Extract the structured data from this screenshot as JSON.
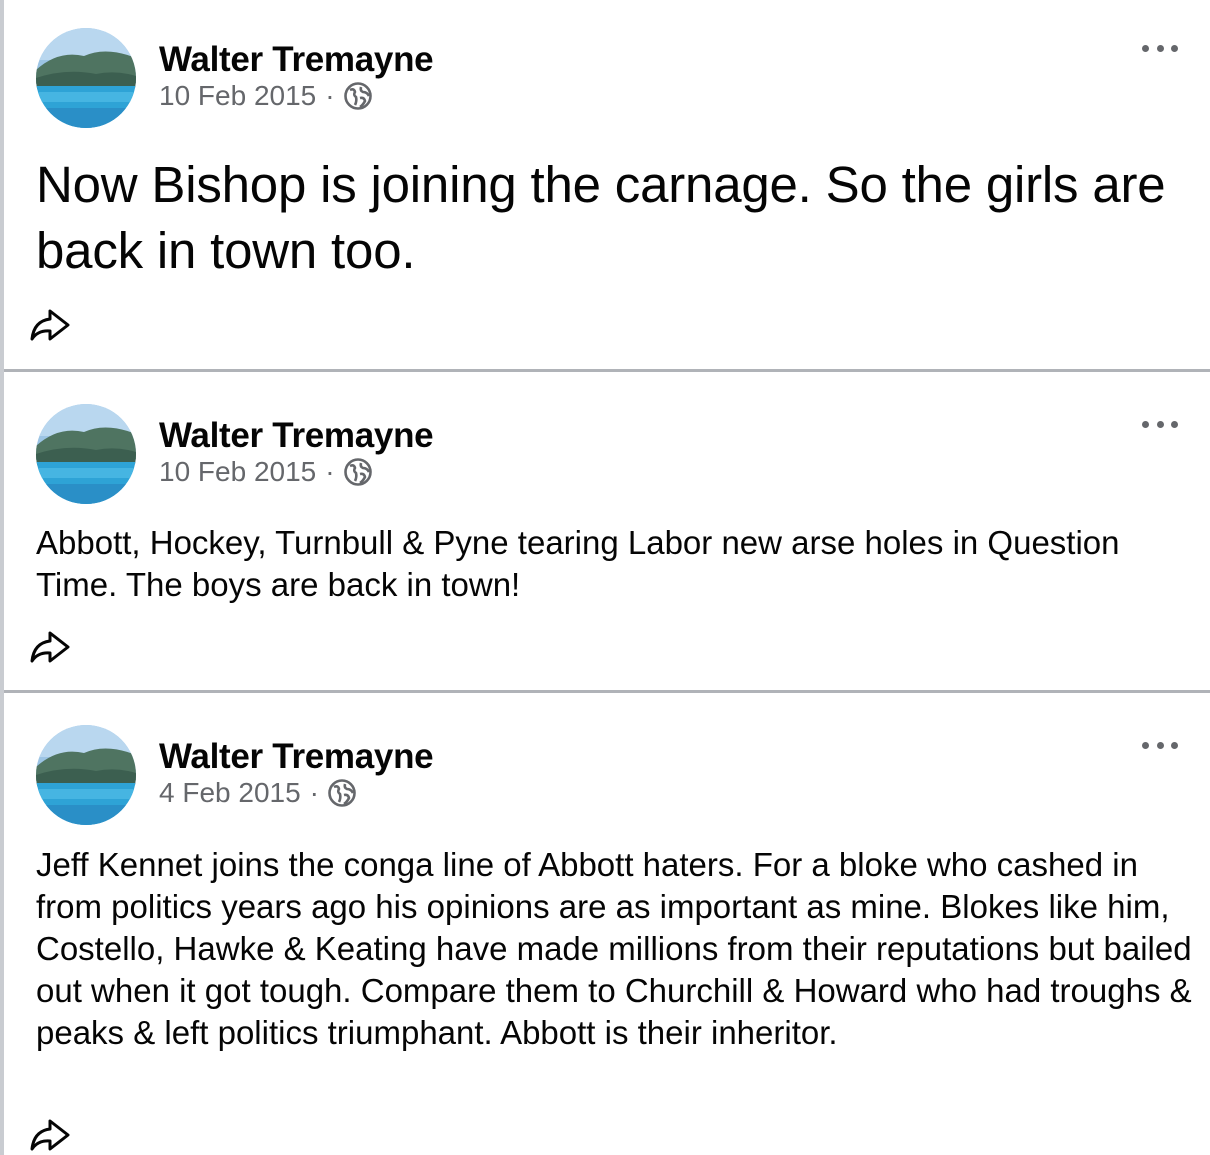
{
  "posts": [
    {
      "author": "Walter Tremayne",
      "date": "10 Feb 2015",
      "separator": "·",
      "audience_icon": "globe-icon",
      "text": "Now Bishop is joining the carnage. So the girls are back in town too.",
      "style": "large"
    },
    {
      "author": "Walter Tremayne",
      "date": "10 Feb 2015",
      "separator": "·",
      "audience_icon": "globe-icon",
      "text": "Abbott, Hockey, Turnbull & Pyne tearing Labor new arse holes in Question Time. The boys are back in town!",
      "style": "normal"
    },
    {
      "author": "Walter Tremayne",
      "date": "4 Feb 2015",
      "separator": "·",
      "audience_icon": "globe-icon",
      "text": "Jeff Kennet joins the conga line of Abbott haters. For a bloke who cashed in from politics years ago his opinions are as important as mine. Blokes like him,  Costello, Hawke & Keating have made millions from their reputations but bailed out when it got tough. Compare them to Churchill & Howard who had troughs & peaks & left politics triumphant. Abbott is their inheritor.",
      "style": "normal"
    }
  ],
  "colors": {
    "text": "#050505",
    "secondary_text": "#65676b",
    "divider": "#b0b3b8"
  }
}
